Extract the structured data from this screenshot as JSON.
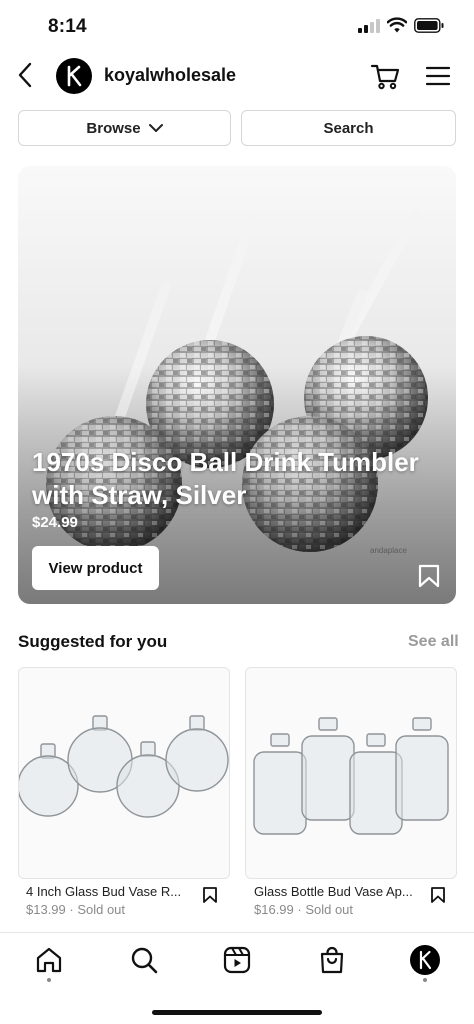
{
  "status_bar": {
    "time": "8:14",
    "icons": [
      "cellular-signal-icon",
      "wifi-icon",
      "battery-icon"
    ]
  },
  "header": {
    "back_icon": "chevron-left-icon",
    "profile_name": "koyalwholesale",
    "avatar_letter": "K",
    "cart_icon": "cart-icon",
    "menu_icon": "hamburger-menu-icon"
  },
  "actions": {
    "browse_label": "Browse",
    "search_label": "Search"
  },
  "featured": {
    "title": "1970s Disco Ball Drink Tumbler with Straw, Silver",
    "price": "$24.99",
    "button_label": "View product",
    "watermark": "andaplace",
    "save_icon": "bookmark-icon"
  },
  "suggested": {
    "title": "Suggested for you",
    "see_all": "See all",
    "products": [
      {
        "name": "4 Inch Glass Bud Vase R...",
        "price": "$13.99",
        "status": "Sold out",
        "meta": "$13.99 · Sold out"
      },
      {
        "name": "Glass Bottle Bud Vase Ap...",
        "price": "$16.99",
        "status": "Sold out",
        "meta": "$16.99 · Sold out"
      }
    ]
  },
  "bottom_nav": {
    "items": [
      "home-icon",
      "search-icon",
      "reels-icon",
      "shop-icon",
      "profile-icon"
    ],
    "active": "home"
  },
  "colors": {
    "text_primary": "#111111",
    "text_secondary": "#8a8a8a",
    "see_all": "#9b9b9b",
    "border": "#d6d6d6"
  }
}
